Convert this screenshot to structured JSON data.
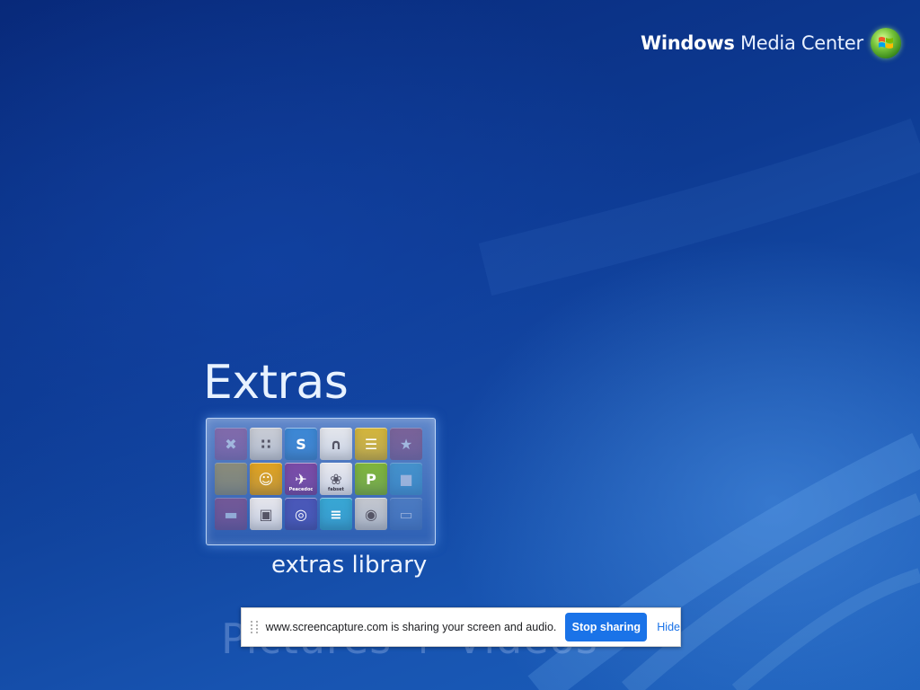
{
  "brand": {
    "windows": "Windows",
    "media_center": "Media Center",
    "logo_icon": "windows-flag-orb-icon"
  },
  "menu": {
    "current_section": "Extras",
    "selected_tile_label": "extras library",
    "next_section_ghost": "Pictures + Videos"
  },
  "tile_apps": [
    {
      "icon": "faded-x-icon",
      "color": "#b04e8a",
      "label": ""
    },
    {
      "icon": "grid-dots-icon",
      "color": "#c9ccd4",
      "label": ""
    },
    {
      "icon": "flash-s-icon",
      "color": "#3c87d4",
      "label": ""
    },
    {
      "icon": "magnet-icon",
      "color": "#e4e6ec",
      "label": ""
    },
    {
      "icon": "news-icon",
      "color": "#d4b53a",
      "label": ""
    },
    {
      "icon": "star-icon",
      "color": "#a03a5f",
      "label": ""
    },
    {
      "icon": "yellow-block-icon",
      "color": "#d6a626",
      "label": ""
    },
    {
      "icon": "people-icon",
      "color": "#e0a21f",
      "label": ""
    },
    {
      "icon": "bird-icon",
      "color": "#7a4aa6",
      "label": "Peacedoc"
    },
    {
      "icon": "flower-icon",
      "color": "#e9e9ef",
      "label": "fabset"
    },
    {
      "icon": "p-coin-icon",
      "color": "#7fb53a",
      "label": ""
    },
    {
      "icon": "cyan-square-icon",
      "color": "#3ab0d8",
      "label": ""
    },
    {
      "icon": "pink-block-icon",
      "color": "#b4426f",
      "label": ""
    },
    {
      "icon": "box-icon",
      "color": "#e6e6ec",
      "label": ""
    },
    {
      "icon": "globe-icon",
      "color": "#4a57b8",
      "label": ""
    },
    {
      "icon": "cards-icon",
      "color": "#38a7d4",
      "label": ""
    },
    {
      "icon": "disc-icon",
      "color": "#c4c7ce",
      "label": ""
    },
    {
      "icon": "monitor-icon",
      "color": "#5b8ac8",
      "label": ""
    }
  ],
  "share_bar": {
    "message": "www.screencapture.com is sharing your screen and audio.",
    "stop_label": "Stop sharing",
    "hide_label": "Hide",
    "accent": "#1a73e8"
  }
}
